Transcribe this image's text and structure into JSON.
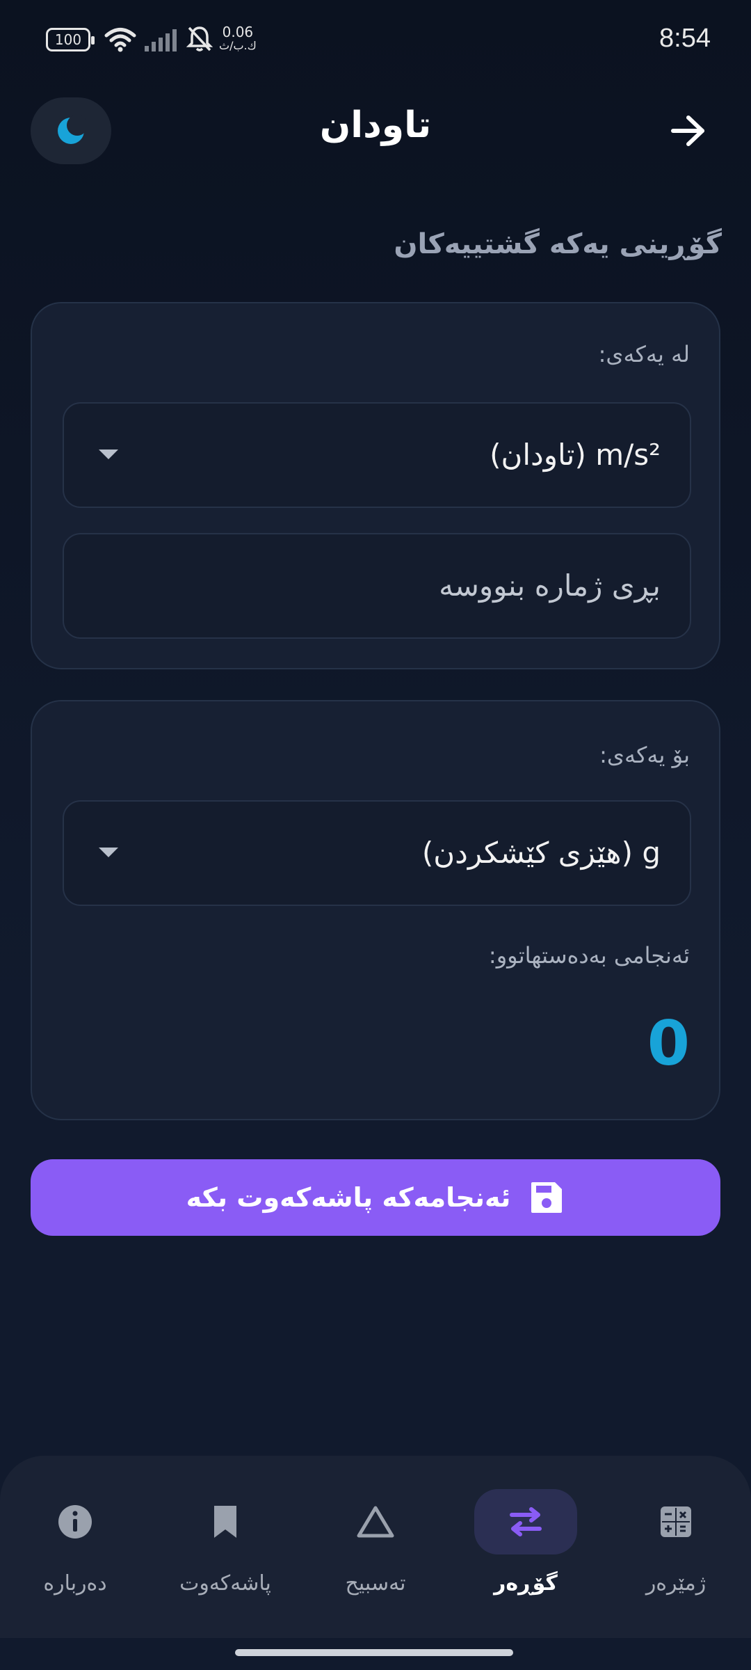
{
  "status_bar": {
    "battery": "100",
    "net_speed": "0.06",
    "net_unit": "ك.ب/ث",
    "time": "8:54"
  },
  "header": {
    "title": "تاودان",
    "theme_icon": "moon-icon",
    "back_icon": "arrow-right-icon"
  },
  "section_title": "گۆڕینی یەکە گشتییەکان",
  "from_card": {
    "label": "لە یەکەی:",
    "selected_unit": "m/s² (تاودان)",
    "input_placeholder": "بڕی ژمارە بنووسە",
    "input_value": ""
  },
  "to_card": {
    "label": "بۆ یەکەی:",
    "selected_unit": "g (هێزی کێشکردن)",
    "result_label": "ئەنجامی بەدەستهاتوو:",
    "result_value": "0"
  },
  "save_button": {
    "label": "ئەنجامەکە پاشەکەوت بکە",
    "icon": "floppy-disk-icon"
  },
  "bottom_nav": {
    "items": [
      {
        "label": "دەربارە",
        "icon": "info-icon",
        "active": false
      },
      {
        "label": "پاشەکەوت",
        "icon": "bookmark-icon",
        "active": false
      },
      {
        "label": "تەسبیح",
        "icon": "triangle-icon",
        "active": false
      },
      {
        "label": "گۆڕەر",
        "icon": "swap-arrows-icon",
        "active": true
      },
      {
        "label": "ژمێرەر",
        "icon": "calculator-icon",
        "active": false
      }
    ]
  },
  "colors": {
    "accent_purple": "#8a5cf5",
    "result_blue": "#18a3d8",
    "card_bg": "#172033"
  }
}
